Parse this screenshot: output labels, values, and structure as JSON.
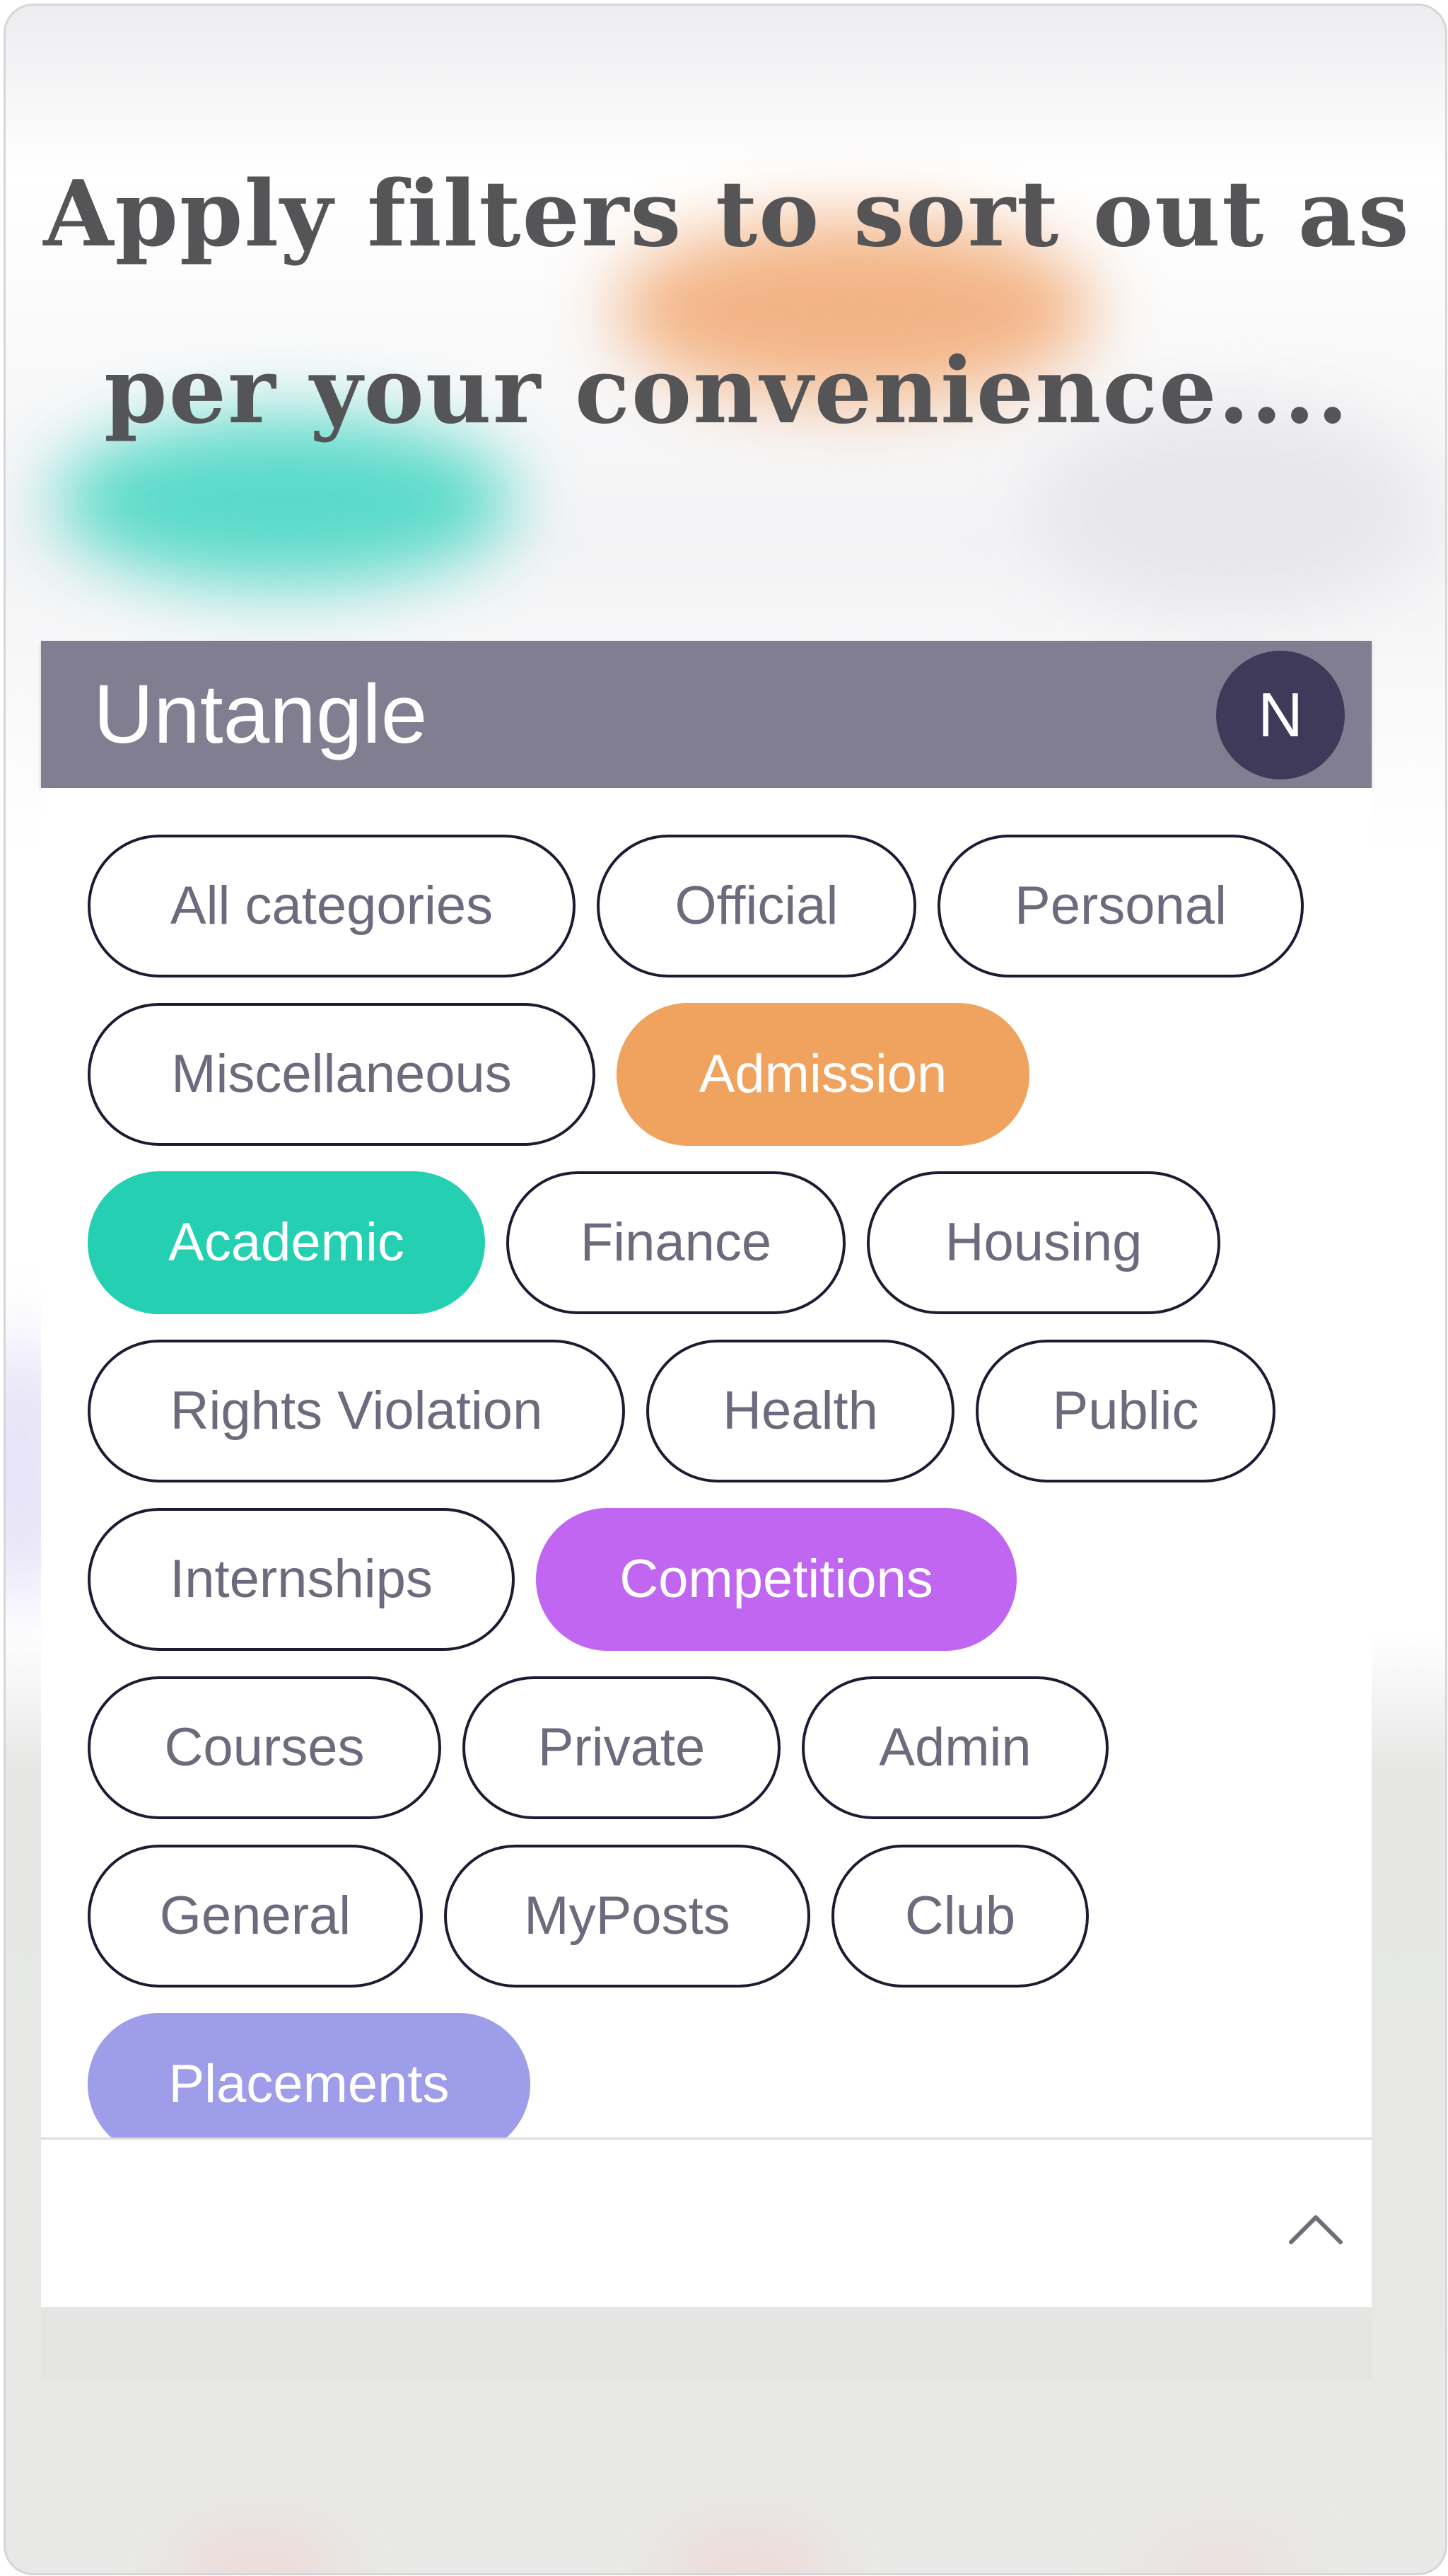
{
  "headline": {
    "line1": "Apply filters to sort out as",
    "line2": "per your convenience...."
  },
  "appbar": {
    "title": "Untangle",
    "avatar_initial": "N"
  },
  "categories": {
    "chips": [
      [
        "All categories",
        "Official",
        "Personal"
      ],
      [
        "Miscellaneous",
        "Admission"
      ],
      [
        "Academic",
        "Finance",
        "Housing"
      ],
      [
        "Rights Violation",
        "Health",
        "Public"
      ],
      [
        "Internships",
        "Competitions"
      ],
      [
        "Courses",
        "Private",
        "Admin"
      ],
      [
        "General",
        "MyPosts",
        "Club"
      ],
      [
        "Placements"
      ]
    ],
    "selected": [
      "Admission",
      "Academic",
      "Competitions",
      "Placements"
    ],
    "colors": {
      "Admission": "#f0a25f",
      "Academic": "#24cfb2",
      "Competitions": "#c066f1",
      "Placements": "#9d9de9"
    }
  },
  "footer": {
    "collapse_icon": "chevron-up-icon"
  }
}
